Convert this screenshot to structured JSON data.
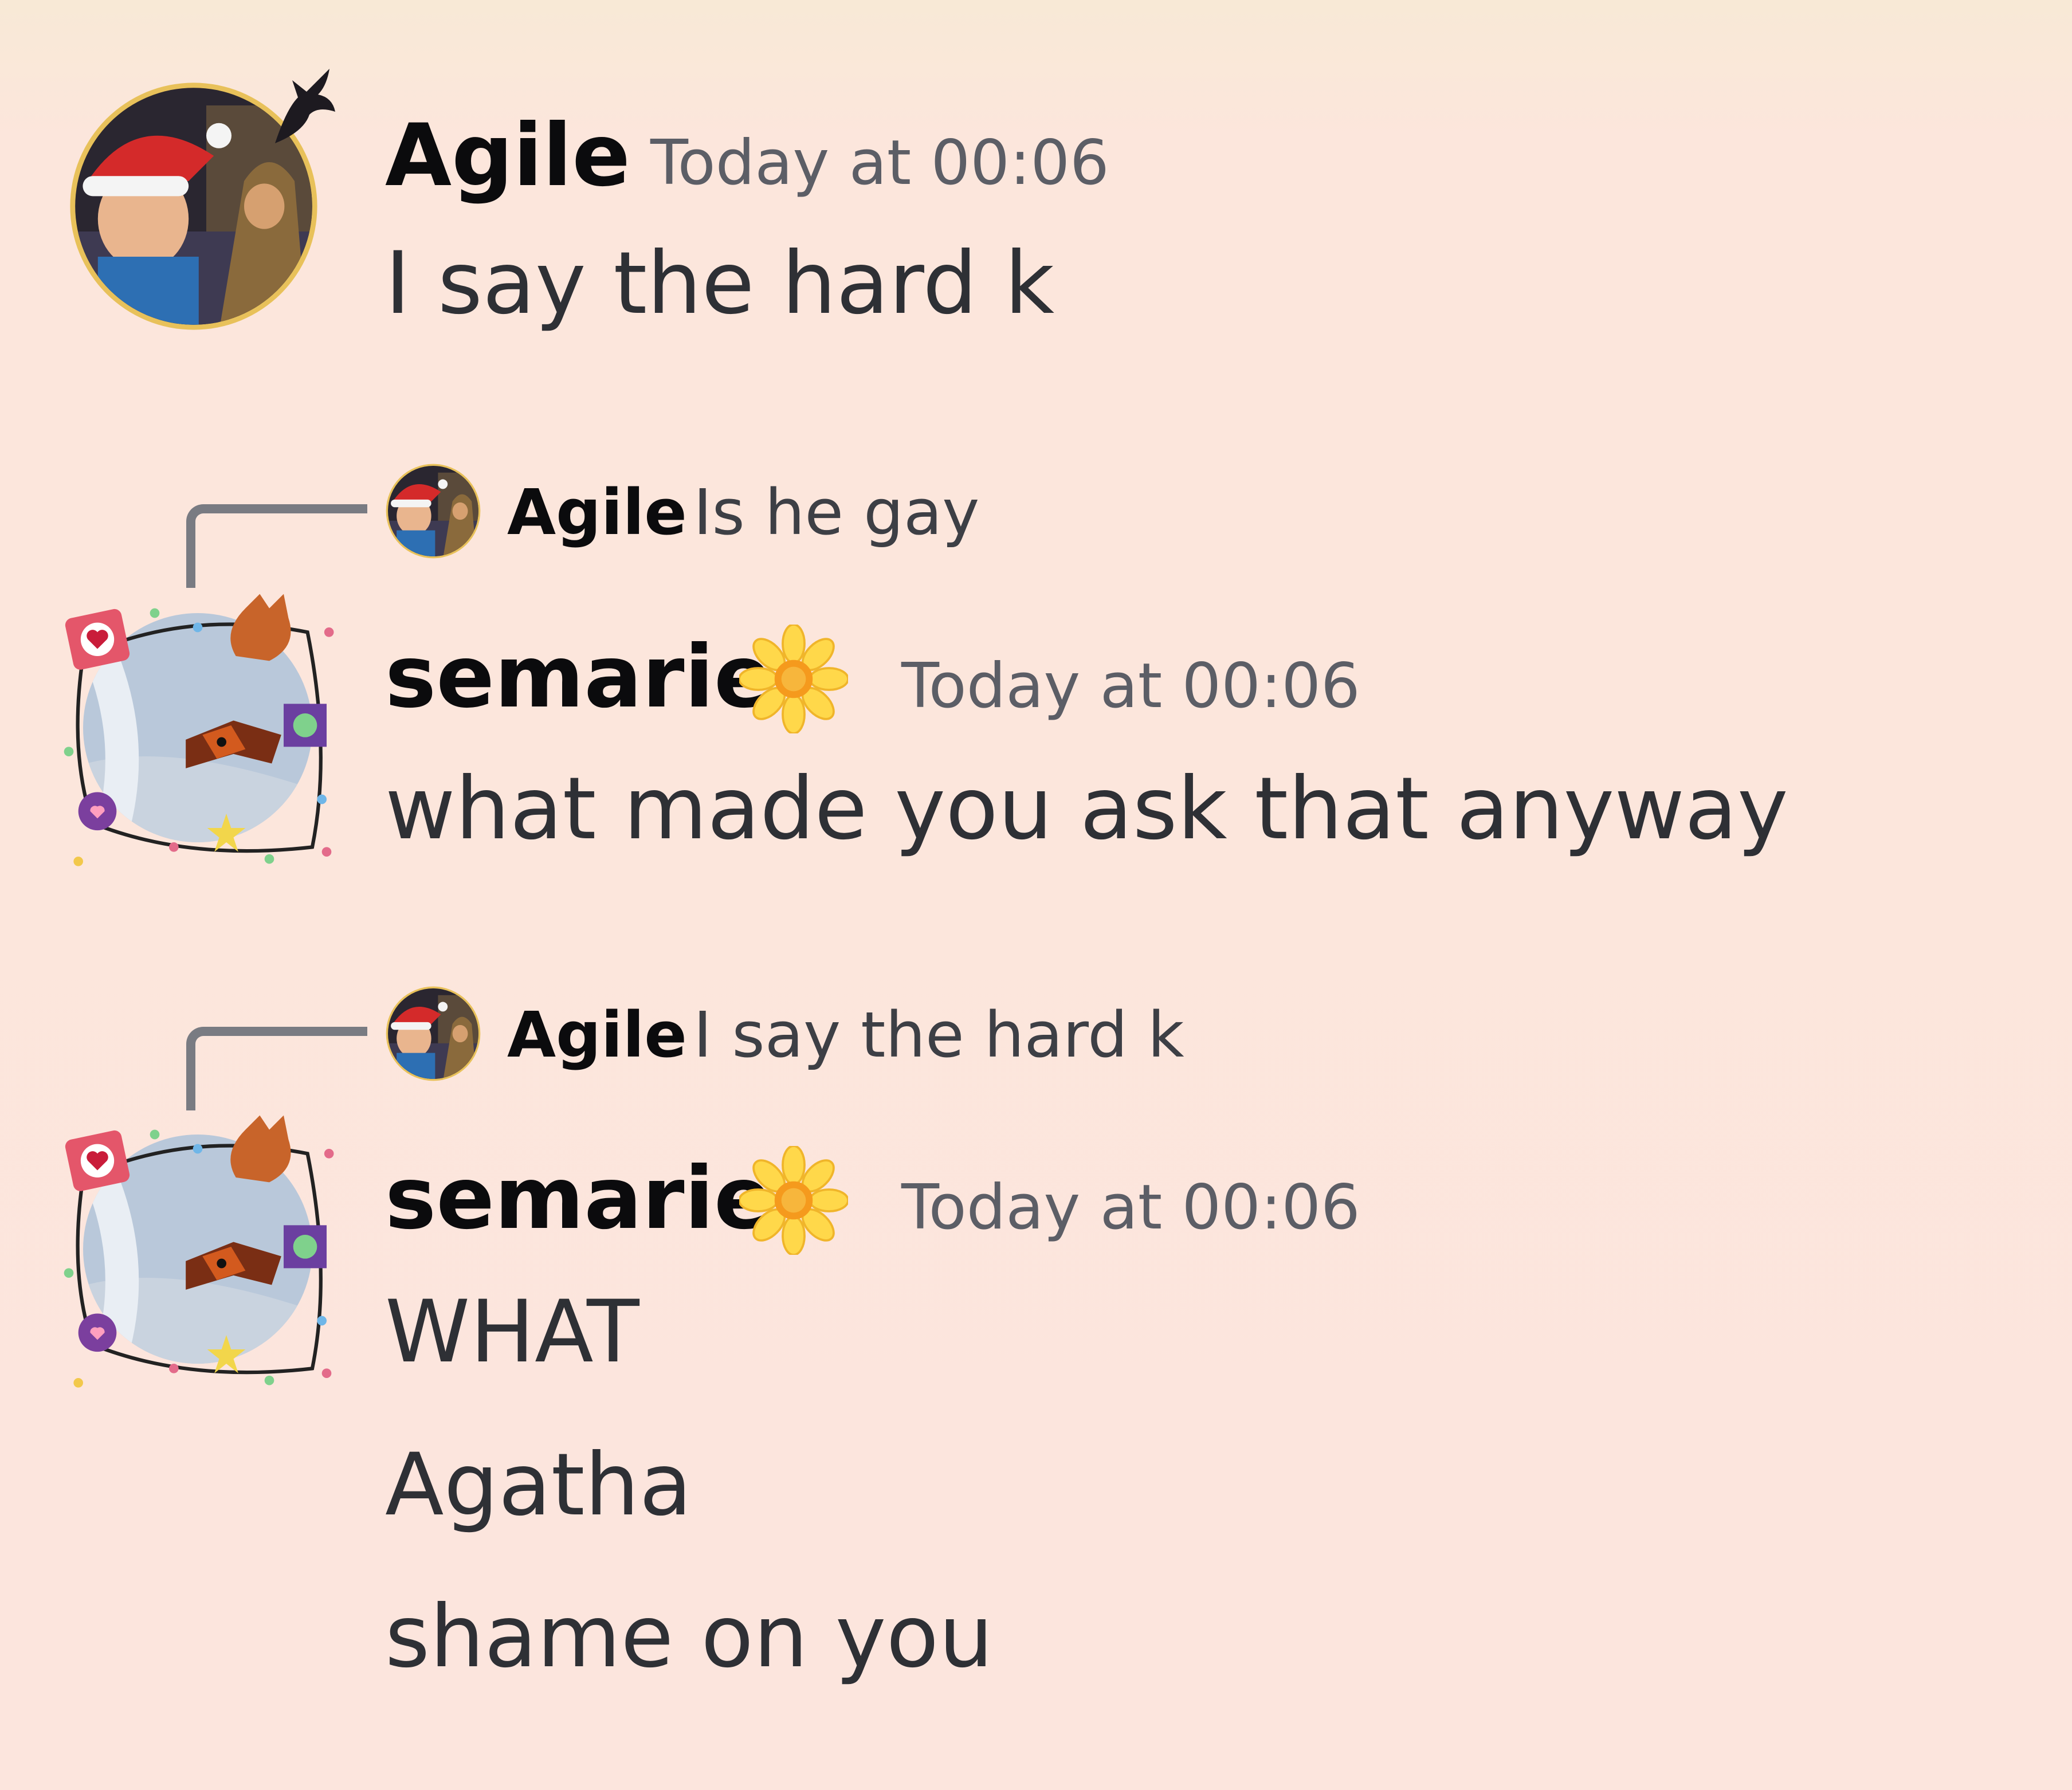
{
  "messages": [
    {
      "author": "Agile",
      "timestamp": "Today at 00:06",
      "lines": [
        "I say the hard k"
      ]
    },
    {
      "reply_to": {
        "author": "Agile",
        "text": "Is he gay"
      },
      "author": "semarie",
      "author_badge": "sunflower-emoji",
      "timestamp": "Today at 00:06",
      "lines": [
        "what made you ask that anyway"
      ]
    },
    {
      "reply_to": {
        "author": "Agile",
        "text": "I say the hard k"
      },
      "author": "semarie",
      "author_badge": "sunflower-emoji",
      "timestamp": "Today at 00:06",
      "lines": [
        "WHAT",
        "Agatha",
        "shame on you"
      ]
    }
  ],
  "colors": {
    "background": "#fce5dd",
    "username": "#0b0b0d",
    "timestamp": "#5c5e66",
    "message_text": "#2e3035",
    "reply_connector": "#797b82"
  }
}
